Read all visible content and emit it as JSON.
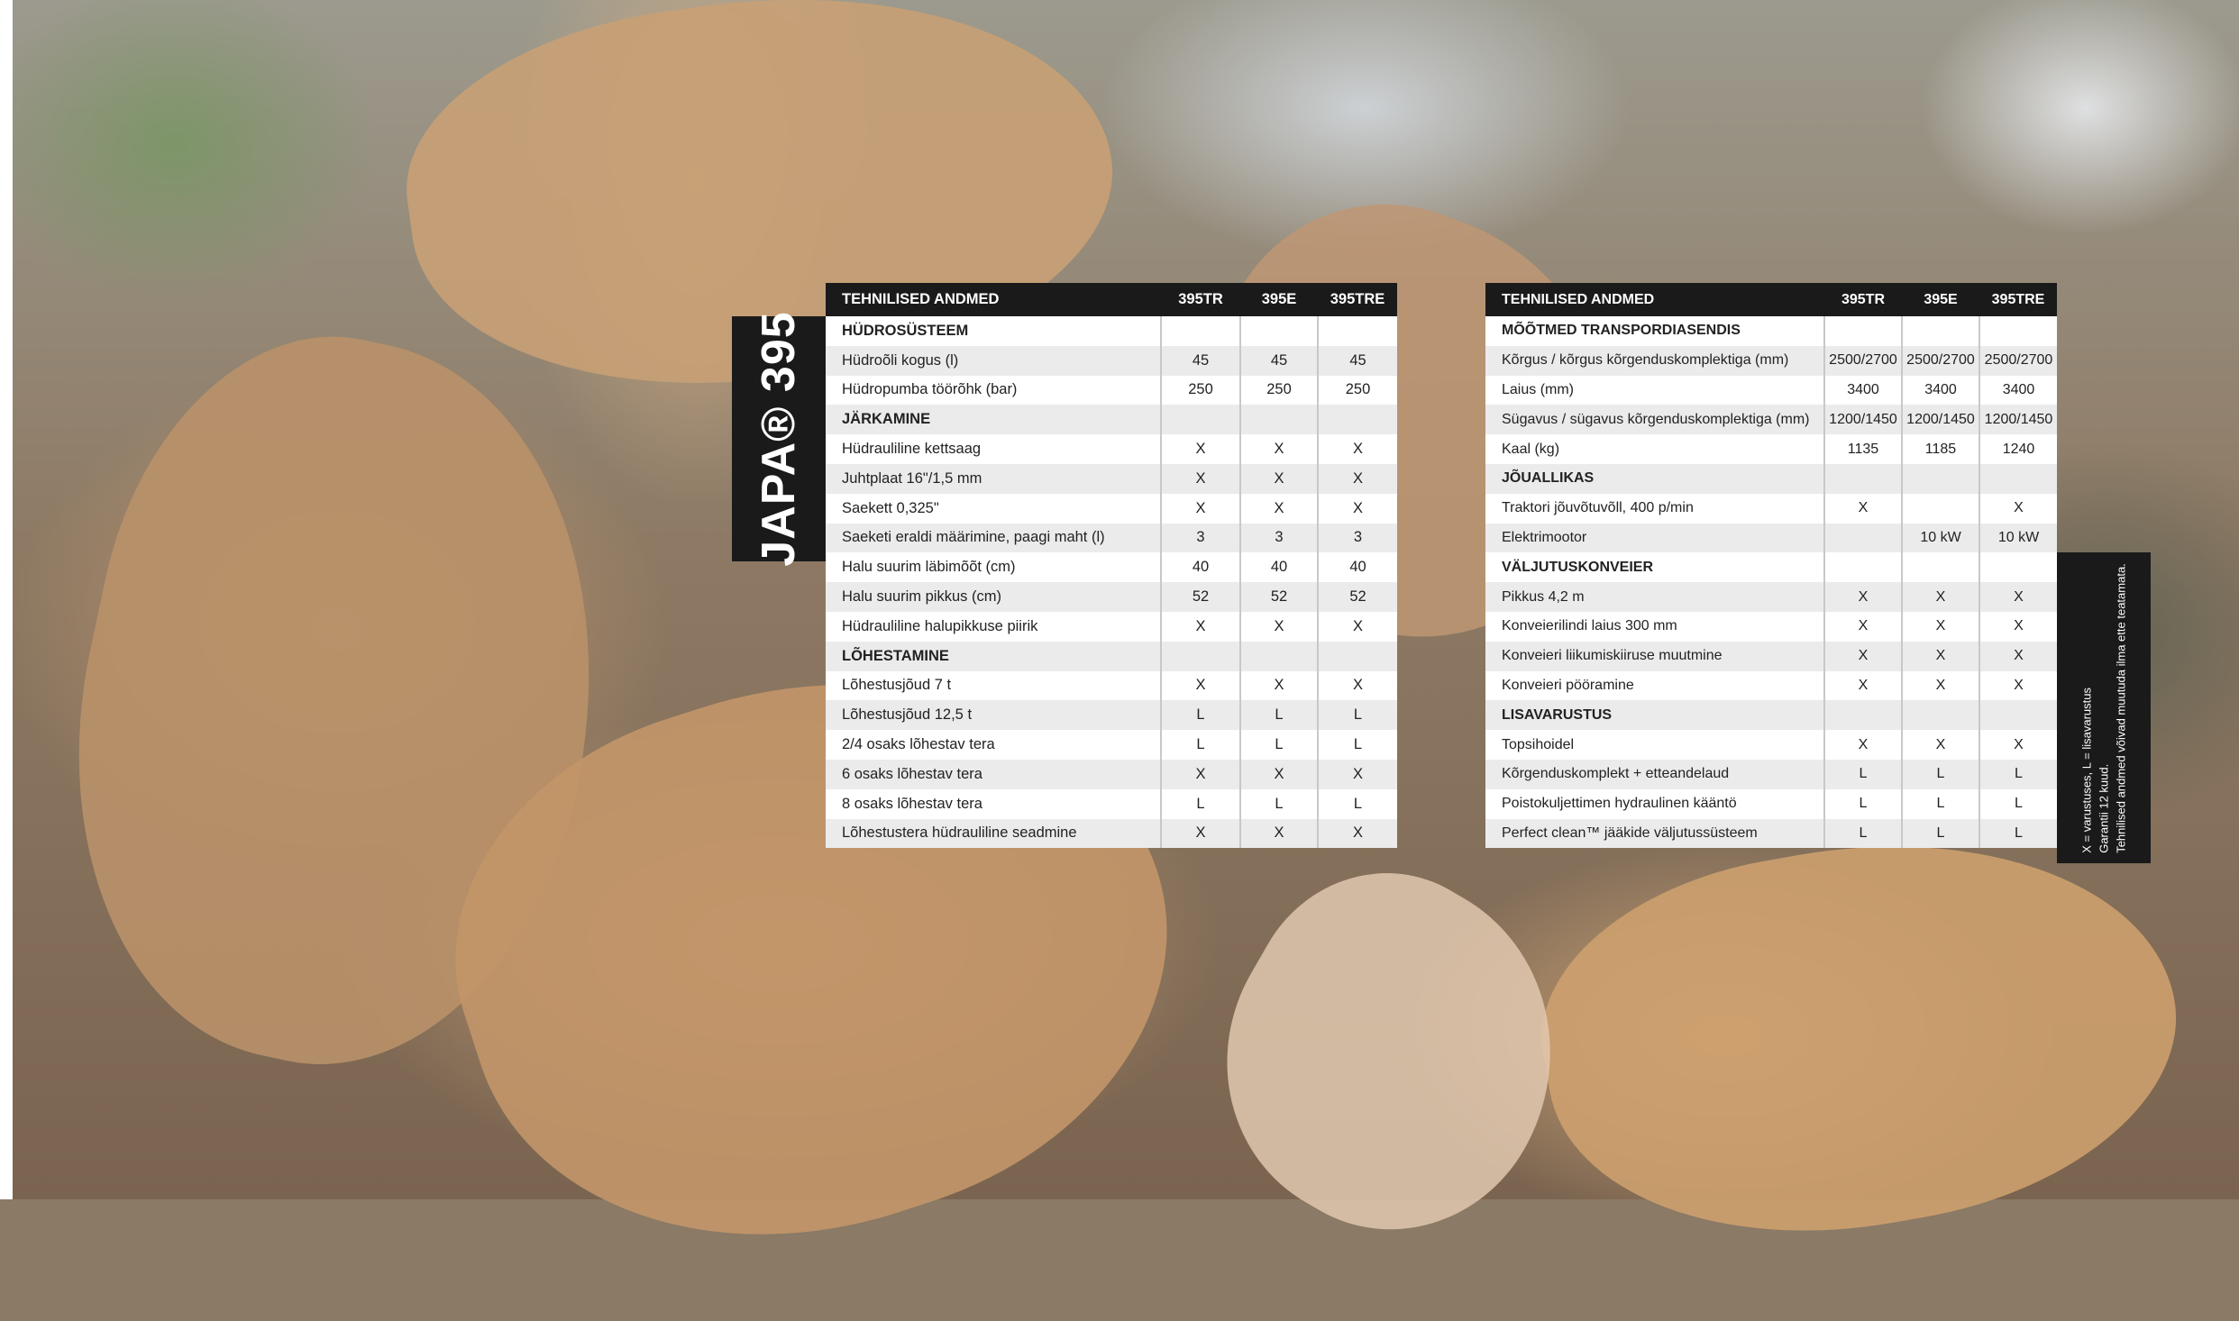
{
  "brand_label": "JAPA® 395",
  "table1": {
    "header": [
      "TEHNILISED ANDMED",
      "395TR",
      "395E",
      "395TRE"
    ],
    "rows": [
      {
        "label": "HÜDROSÜSTEEM",
        "section": true,
        "v": [
          "",
          "",
          ""
        ]
      },
      {
        "label": "Hüdroõli kogus (l)",
        "v": [
          "45",
          "45",
          "45"
        ]
      },
      {
        "label": "Hüdropumba töörõhk (bar)",
        "v": [
          "250",
          "250",
          "250"
        ]
      },
      {
        "label": "JÄRKAMINE",
        "section": true,
        "v": [
          "",
          "",
          ""
        ]
      },
      {
        "label": "Hüdrauliline kettsaag",
        "v": [
          "X",
          "X",
          "X"
        ]
      },
      {
        "label": "Juhtplaat 16\"/1,5 mm",
        "v": [
          "X",
          "X",
          "X"
        ]
      },
      {
        "label": "Saekett 0,325\"",
        "v": [
          "X",
          "X",
          "X"
        ]
      },
      {
        "label": "Saeketi eraldi määrimine, paagi maht (l)",
        "v": [
          "3",
          "3",
          "3"
        ]
      },
      {
        "label": "Halu suurim läbimõõt (cm)",
        "v": [
          "40",
          "40",
          "40"
        ]
      },
      {
        "label": "Halu suurim pikkus (cm)",
        "v": [
          "52",
          "52",
          "52"
        ]
      },
      {
        "label": "Hüdrauliline halupikkuse piirik",
        "v": [
          "X",
          "X",
          "X"
        ]
      },
      {
        "label": "LÕHESTAMINE",
        "section": true,
        "v": [
          "",
          "",
          ""
        ]
      },
      {
        "label": "Lõhestusjõud 7 t",
        "v": [
          "X",
          "X",
          "X"
        ]
      },
      {
        "label": "Lõhestusjõud 12,5 t",
        "v": [
          "L",
          "L",
          "L"
        ]
      },
      {
        "label": "2/4 osaks lõhestav tera",
        "v": [
          "L",
          "L",
          "L"
        ]
      },
      {
        "label": "6 osaks lõhestav tera",
        "v": [
          "X",
          "X",
          "X"
        ]
      },
      {
        "label": "8 osaks lõhestav tera",
        "v": [
          "L",
          "L",
          "L"
        ]
      },
      {
        "label": "Lõhestustera hüdrauliline seadmine",
        "v": [
          "X",
          "X",
          "X"
        ]
      }
    ]
  },
  "table2": {
    "header": [
      "TEHNILISED ANDMED",
      "395TR",
      "395E",
      "395TRE"
    ],
    "rows": [
      {
        "label": "MÕÕTMED TRANSPORDIASENDIS",
        "section": true,
        "v": [
          "",
          "",
          ""
        ]
      },
      {
        "label": "Kõrgus / kõrgus kõrgenduskomplektiga (mm)",
        "v": [
          "2500/2700",
          "2500/2700",
          "2500/2700"
        ]
      },
      {
        "label": "Laius (mm)",
        "v": [
          "3400",
          "3400",
          "3400"
        ]
      },
      {
        "label": "Sügavus / sügavus kõrgenduskomplektiga (mm)",
        "v": [
          "1200/1450",
          "1200/1450",
          "1200/1450"
        ]
      },
      {
        "label": "Kaal (kg)",
        "v": [
          "1135",
          "1185",
          "1240"
        ]
      },
      {
        "label": "JÕUALLIKAS",
        "section": true,
        "v": [
          "",
          "",
          ""
        ]
      },
      {
        "label": "Traktori jõuvõtuvõll, 400 p/min",
        "v": [
          "X",
          "",
          "X"
        ]
      },
      {
        "label": "Elektrimootor",
        "v": [
          "",
          "10 kW",
          "10 kW"
        ]
      },
      {
        "label": "VÄLJUTUSKONVEIER",
        "section": true,
        "v": [
          "",
          "",
          ""
        ]
      },
      {
        "label": "Pikkus 4,2 m",
        "v": [
          "X",
          "X",
          "X"
        ]
      },
      {
        "label": "Konveierilindi laius 300 mm",
        "v": [
          "X",
          "X",
          "X"
        ]
      },
      {
        "label": "Konveieri liikumiskiiruse muutmine",
        "v": [
          "X",
          "X",
          "X"
        ]
      },
      {
        "label": "Konveieri pööramine",
        "v": [
          "X",
          "X",
          "X"
        ]
      },
      {
        "label": "LISAVARUSTUS",
        "section": true,
        "v": [
          "",
          "",
          ""
        ]
      },
      {
        "label": "Topsihoidel",
        "v": [
          "X",
          "X",
          "X"
        ]
      },
      {
        "label": "Kõrgenduskomplekt + etteandelaud",
        "v": [
          "L",
          "L",
          "L"
        ]
      },
      {
        "label": "Poistokuljettimen hydraulinen kääntö",
        "v": [
          "L",
          "L",
          "L"
        ]
      },
      {
        "label": "Perfect clean™ jääkide väljutussüsteem",
        "v": [
          "L",
          "L",
          "L"
        ]
      }
    ]
  },
  "notes": [
    "X = varustuses, L = lisavarustus",
    "Garantii 12 kuud.",
    "Tehnilised andmed võivad muutuda ilma ette teatamata."
  ]
}
